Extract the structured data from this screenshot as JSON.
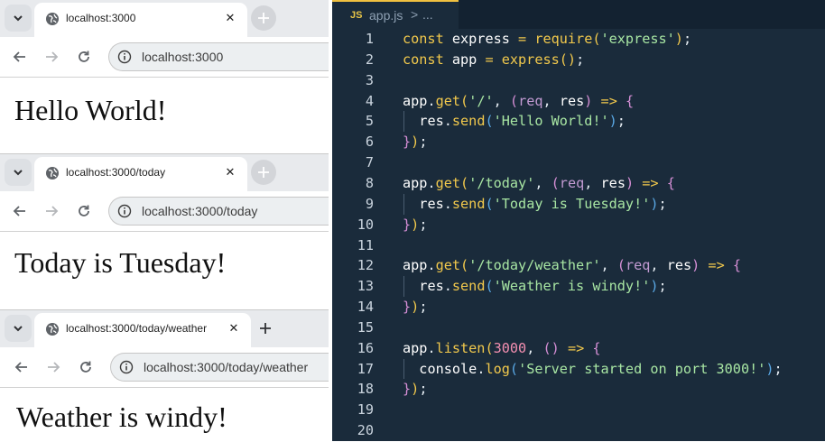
{
  "browsers": [
    {
      "tab_title": "localhost:3000",
      "url": "localhost:3000",
      "page_text": "Hello World!"
    },
    {
      "tab_title": "localhost:3000/today",
      "url": "localhost:3000/today",
      "page_text": "Today is Tuesday!"
    },
    {
      "tab_title": "localhost:3000/today/weather",
      "url": "localhost:3000/today/weather",
      "page_text": "Weather is windy!"
    }
  ],
  "editor": {
    "file_icon": "JS",
    "file_name": "app.js",
    "breadcrumb_sep": ">",
    "breadcrumb_more": "...",
    "accent": "#f0c040",
    "background": "#1a2b3b",
    "lines": [
      {
        "n": "1",
        "tokens": [
          [
            "kw",
            "const "
          ],
          [
            "id",
            "express "
          ],
          [
            "op",
            "= "
          ],
          [
            "fn",
            "require"
          ],
          [
            "br1",
            "("
          ],
          [
            "str",
            "'express'"
          ],
          [
            "br1",
            ")"
          ],
          [
            "pl",
            ";"
          ]
        ]
      },
      {
        "n": "2",
        "tokens": [
          [
            "kw",
            "const "
          ],
          [
            "id",
            "app "
          ],
          [
            "op",
            "= "
          ],
          [
            "fn",
            "express"
          ],
          [
            "br1",
            "()"
          ],
          [
            "pl",
            ";"
          ]
        ]
      },
      {
        "n": "3",
        "tokens": []
      },
      {
        "n": "4",
        "tokens": [
          [
            "id",
            "app"
          ],
          [
            "pl",
            "."
          ],
          [
            "fn",
            "get"
          ],
          [
            "br1",
            "("
          ],
          [
            "str",
            "'/'"
          ],
          [
            "pl",
            ", "
          ],
          [
            "br2",
            "("
          ],
          [
            "par",
            "req"
          ],
          [
            "pl",
            ", "
          ],
          [
            "id",
            "res"
          ],
          [
            "br2",
            ")"
          ],
          [
            "op",
            " => "
          ],
          [
            "br2",
            "{"
          ]
        ]
      },
      {
        "n": "5",
        "tokens": [
          [
            "pl",
            "  "
          ],
          [
            "id",
            "res"
          ],
          [
            "pl",
            "."
          ],
          [
            "fn",
            "send"
          ],
          [
            "br3",
            "("
          ],
          [
            "str",
            "'Hello World!'"
          ],
          [
            "br3",
            ")"
          ],
          [
            "pl",
            ";"
          ]
        ]
      },
      {
        "n": "6",
        "tokens": [
          [
            "br2",
            "}"
          ],
          [
            "br1",
            ")"
          ],
          [
            "pl",
            ";"
          ]
        ]
      },
      {
        "n": "7",
        "tokens": []
      },
      {
        "n": "8",
        "tokens": [
          [
            "id",
            "app"
          ],
          [
            "pl",
            "."
          ],
          [
            "fn",
            "get"
          ],
          [
            "br1",
            "("
          ],
          [
            "str",
            "'/today'"
          ],
          [
            "pl",
            ", "
          ],
          [
            "br2",
            "("
          ],
          [
            "par",
            "req"
          ],
          [
            "pl",
            ", "
          ],
          [
            "id",
            "res"
          ],
          [
            "br2",
            ")"
          ],
          [
            "op",
            " => "
          ],
          [
            "br2",
            "{"
          ]
        ]
      },
      {
        "n": "9",
        "tokens": [
          [
            "pl",
            "  "
          ],
          [
            "id",
            "res"
          ],
          [
            "pl",
            "."
          ],
          [
            "fn",
            "send"
          ],
          [
            "br3",
            "("
          ],
          [
            "str",
            "'Today is Tuesday!'"
          ],
          [
            "br3",
            ")"
          ],
          [
            "pl",
            ";"
          ]
        ]
      },
      {
        "n": "10",
        "tokens": [
          [
            "br2",
            "}"
          ],
          [
            "br1",
            ")"
          ],
          [
            "pl",
            ";"
          ]
        ]
      },
      {
        "n": "11",
        "tokens": []
      },
      {
        "n": "12",
        "tokens": [
          [
            "id",
            "app"
          ],
          [
            "pl",
            "."
          ],
          [
            "fn",
            "get"
          ],
          [
            "br1",
            "("
          ],
          [
            "str",
            "'/today/weather'"
          ],
          [
            "pl",
            ", "
          ],
          [
            "br2",
            "("
          ],
          [
            "par",
            "req"
          ],
          [
            "pl",
            ", "
          ],
          [
            "id",
            "res"
          ],
          [
            "br2",
            ")"
          ],
          [
            "op",
            " => "
          ],
          [
            "br2",
            "{"
          ]
        ]
      },
      {
        "n": "13",
        "tokens": [
          [
            "pl",
            "  "
          ],
          [
            "id",
            "res"
          ],
          [
            "pl",
            "."
          ],
          [
            "fn",
            "send"
          ],
          [
            "br3",
            "("
          ],
          [
            "str",
            "'Weather is windy!'"
          ],
          [
            "br3",
            ")"
          ],
          [
            "pl",
            ";"
          ]
        ]
      },
      {
        "n": "14",
        "tokens": [
          [
            "br2",
            "}"
          ],
          [
            "br1",
            ")"
          ],
          [
            "pl",
            ";"
          ]
        ]
      },
      {
        "n": "15",
        "tokens": []
      },
      {
        "n": "16",
        "tokens": [
          [
            "id",
            "app"
          ],
          [
            "pl",
            "."
          ],
          [
            "fn",
            "listen"
          ],
          [
            "br1",
            "("
          ],
          [
            "num",
            "3000"
          ],
          [
            "pl",
            ", "
          ],
          [
            "br2",
            "()"
          ],
          [
            "op",
            " => "
          ],
          [
            "br2",
            "{"
          ]
        ]
      },
      {
        "n": "17",
        "tokens": [
          [
            "pl",
            "  "
          ],
          [
            "id",
            "console"
          ],
          [
            "pl",
            "."
          ],
          [
            "fn",
            "log"
          ],
          [
            "br3",
            "("
          ],
          [
            "str",
            "'Server started on port 3000!'"
          ],
          [
            "br3",
            ")"
          ],
          [
            "pl",
            ";"
          ]
        ]
      },
      {
        "n": "18",
        "tokens": [
          [
            "br2",
            "}"
          ],
          [
            "br1",
            ")"
          ],
          [
            "pl",
            ";"
          ]
        ]
      },
      {
        "n": "19",
        "tokens": []
      },
      {
        "n": "20",
        "tokens": []
      }
    ]
  }
}
